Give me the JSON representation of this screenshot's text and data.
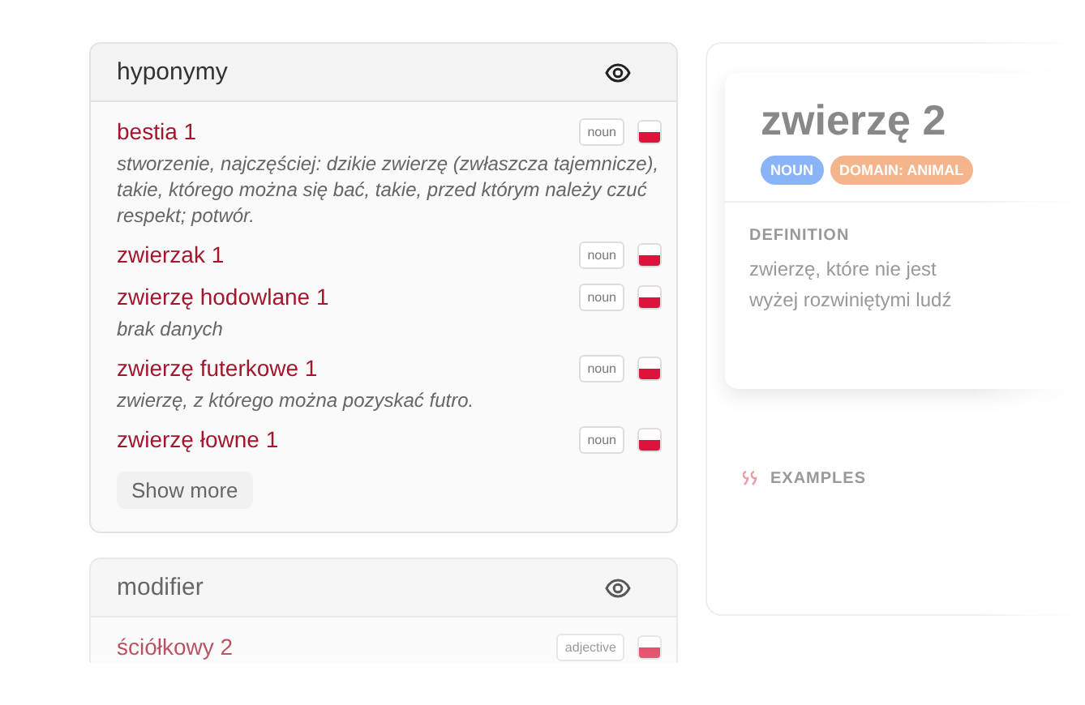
{
  "panels": [
    {
      "title": "hyponymy",
      "show_more": "Show more",
      "entries": [
        {
          "word": "bestia 1",
          "pos": "noun",
          "definition": "stworzenie, najczęściej: dzikie zwierzę (zwłaszcza tajemnicze), takie, którego można się bać, takie, przed którym należy czuć respekt; potwór."
        },
        {
          "word": "zwierzak 1",
          "pos": "noun"
        },
        {
          "word": "zwierzę hodowlane 1",
          "pos": "noun",
          "definition": "brak danych"
        },
        {
          "word": "zwierzę futerkowe 1",
          "pos": "noun",
          "definition": "zwierzę, z którego można pozyskać futro."
        },
        {
          "word": "zwierzę łowne 1",
          "pos": "noun"
        }
      ]
    },
    {
      "title": "modifier",
      "entries": [
        {
          "word": "ściółkowy 2",
          "pos": "adjective"
        }
      ]
    }
  ],
  "sense": {
    "title": "zwierzę 2",
    "tags": [
      {
        "label": "NOUN",
        "kind": "pos"
      },
      {
        "label": "DOMAIN: ANIMAL",
        "kind": "domain"
      }
    ],
    "definition_heading": "DEFINITION",
    "definition_lines": [
      "zwierzę, które nie jest",
      "wyżej rozwiniętymi ludź"
    ],
    "examples_heading": "EXAMPLES"
  }
}
